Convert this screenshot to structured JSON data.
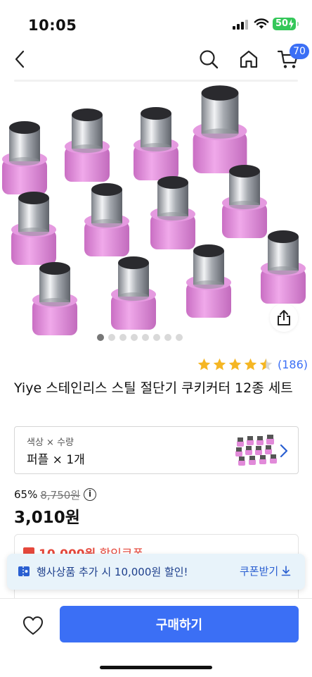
{
  "status_bar": {
    "time": "10:05",
    "battery": "50"
  },
  "nav": {
    "cart_count": "70"
  },
  "gallery": {
    "dot_count": 8,
    "active_index": 0
  },
  "rating": {
    "score": 4.5,
    "max": 5,
    "review_count": "(186)"
  },
  "product": {
    "title": "Yiye 스테인리스 스틸 절단기 쿠키커터 12종 세트"
  },
  "option": {
    "label": "색상 × 수량",
    "value": "퍼플 × 1개"
  },
  "price": {
    "discount_rate": "65%",
    "original_price": "8,750원",
    "info_icon": "i",
    "sale_price": "3,010원"
  },
  "coupon_card": {
    "amount": "10,000원",
    "label": "할인쿠폰"
  },
  "toast": {
    "message": "행사상품 추가 시 10,000원 할인!",
    "action_label": "쿠폰받기"
  },
  "bottom_bar": {
    "buy_label": "구매하기"
  },
  "colors": {
    "accent": "#3b6ff5",
    "star": "#f5b623",
    "coupon_red": "#e5483c",
    "toast_bg": "#e8f3fa",
    "cutter_pink": "#e18ad9",
    "battery_green": "#34c759"
  },
  "icons": {
    "back": "chevron-left-icon",
    "search": "search-icon",
    "home": "home-icon",
    "cart": "cart-icon",
    "share": "share-icon",
    "like": "heart-icon",
    "coupon": "coupon-icon",
    "download": "download-icon",
    "option": "chevron-right-icon"
  }
}
